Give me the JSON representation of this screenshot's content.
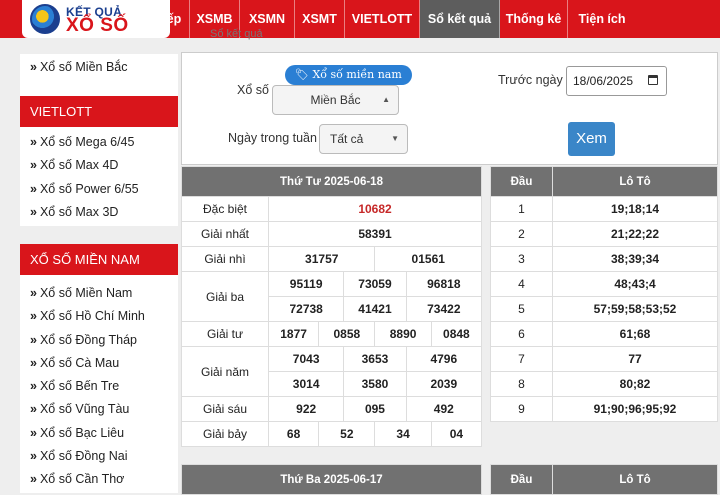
{
  "logo": {
    "line1": "KẾT QUẢ",
    "line2": "XỔ SỐ"
  },
  "nav": {
    "items": [
      "Trực tiếp",
      "XSMB",
      "XSMN",
      "XSMT",
      "VIETLOTT",
      "Sổ kết quả",
      "Thống kê",
      "Tiện ích"
    ],
    "active": "Sổ kết quả"
  },
  "breadcrumb": "Sổ kết quả",
  "sidebar": {
    "top_items": [
      "Xổ số Miền Bắc"
    ],
    "vietlott": {
      "header": "VIETLOTT",
      "items": [
        "Xổ số Mega 6/45",
        "Xổ số Max 4D",
        "Xổ số Power 6/55",
        "Xổ số Max 3D"
      ]
    },
    "mien_nam": {
      "header": "XỔ SỐ MIỀN NAM",
      "items": [
        "Xổ số Miền Nam",
        "Xổ số Hồ Chí Minh",
        "Xổ số Đồng Tháp",
        "Xổ số Cà Mau",
        "Xổ số Bến Tre",
        "Xổ số Vũng Tàu",
        "Xổ số Bạc Liêu",
        "Xổ số Đồng Nai",
        "Xổ số Cần Thơ"
      ]
    }
  },
  "form": {
    "badge": "Xổ số miền nam",
    "xoso_label": "Xổ số",
    "xoso_value": "Miền Bắc",
    "ngay_label": "Ngày trong tuần",
    "ngay_value": "Tất cả",
    "truoc_label": "Trước ngày",
    "date_value": "18/06/2025",
    "submit": "Xem"
  },
  "result1": {
    "title": "Thứ Tư 2025-06-18",
    "prizes": {
      "dacbiet_label": "Đặc biệt",
      "dacbiet": "10682",
      "nhat_label": "Giải nhất",
      "nhat": "58391",
      "nhi_label": "Giải nhì",
      "nhi": [
        "31757",
        "01561"
      ],
      "ba_label": "Giải ba",
      "ba": [
        "95119",
        "73059",
        "96818",
        "72738",
        "41421",
        "73422"
      ],
      "tu_label": "Giải tư",
      "tu": [
        "1877",
        "0858",
        "8890",
        "0848"
      ],
      "nam_label": "Giải năm",
      "nam": [
        "7043",
        "3653",
        "4796",
        "3014",
        "3580",
        "2039"
      ],
      "sau_label": "Giải sáu",
      "sau": [
        "922",
        "095",
        "492"
      ],
      "bay_label": "Giải bảy",
      "bay": [
        "68",
        "52",
        "34",
        "04"
      ]
    }
  },
  "loto1": {
    "col1": "Đầu",
    "col2": "Lô Tô",
    "rows": [
      [
        "1",
        "19;18;14"
      ],
      [
        "2",
        "21;22;22"
      ],
      [
        "3",
        "38;39;34"
      ],
      [
        "4",
        "48;43;4"
      ],
      [
        "5",
        "57;59;58;53;52"
      ],
      [
        "6",
        "61;68"
      ],
      [
        "7",
        "77"
      ],
      [
        "8",
        "80;82"
      ],
      [
        "9",
        "91;90;96;95;92"
      ]
    ]
  },
  "result2": {
    "title": "Thứ Ba 2025-06-17"
  },
  "loto2": {
    "col1": "Đầu",
    "col2": "Lô Tô"
  }
}
